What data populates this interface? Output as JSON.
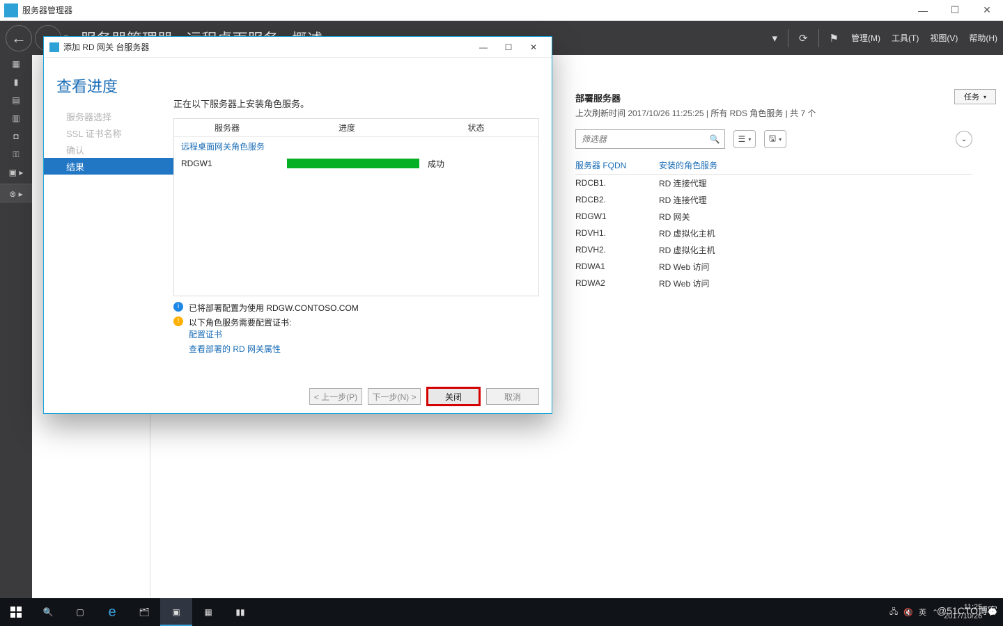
{
  "app": {
    "title": "服务器管理器"
  },
  "window_buttons": {
    "min": "—",
    "max": "☐",
    "close": "✕"
  },
  "header": {
    "breadcrumb": "服务器管理器 · 远程桌面服务 · 概述",
    "menus": {
      "manage": "管理(M)",
      "tools": "工具(T)",
      "view": "视图(V)",
      "help": "帮助(H)"
    }
  },
  "main": {
    "panel_title": "部署服务器",
    "panel_subtitle": "上次刷新时间 2017/10/26 11:25:25 | 所有 RDS 角色服务  | 共 7 个",
    "tasks_label": "任务",
    "filter_placeholder": "筛选器",
    "columns": {
      "fqdn": "服务器 FQDN",
      "role": "安装的角色服务"
    },
    "rows": [
      {
        "fqdn": "RDCB1.",
        "role": "RD 连接代理"
      },
      {
        "fqdn": "RDCB2.",
        "role": "RD 连接代理"
      },
      {
        "fqdn": "RDGW1",
        "role": "RD 网关"
      },
      {
        "fqdn": "RDVH1.",
        "role": "RD 虚拟化主机"
      },
      {
        "fqdn": "RDVH2.",
        "role": "RD 虚拟化主机"
      },
      {
        "fqdn": "RDWA1",
        "role": "RD Web 访问"
      },
      {
        "fqdn": "RDWA2",
        "role": "RD Web 访问"
      }
    ]
  },
  "dialog": {
    "title": "添加 RD 网关 台服务器",
    "heading": "查看进度",
    "steps": {
      "s1": "服务器选择",
      "s2": "SSL 证书名称",
      "s3": "确认",
      "s4": "结果"
    },
    "subtext": "正在以下服务器上安装角色服务。",
    "table": {
      "cols": {
        "server": "服务器",
        "progress": "进度",
        "status": "状态"
      },
      "group": "远程桌面网关角色服务",
      "row": {
        "server": "RDGW1",
        "status": "成功"
      }
    },
    "notes": {
      "info": "已将部署配置为使用 RDGW.CONTOSO.COM",
      "warn": "以下角色服务需要配置证书:",
      "warn_link": "配置证书",
      "view_link": "查看部署的 RD 网关属性"
    },
    "buttons": {
      "prev": "< 上一步(P)",
      "next": "下一步(N) >",
      "close": "关闭",
      "cancel": "取消"
    }
  },
  "taskbar": {
    "ime": "英",
    "time": "11:25",
    "date": "2017/10/26",
    "watermark": "@51CTO博客"
  }
}
